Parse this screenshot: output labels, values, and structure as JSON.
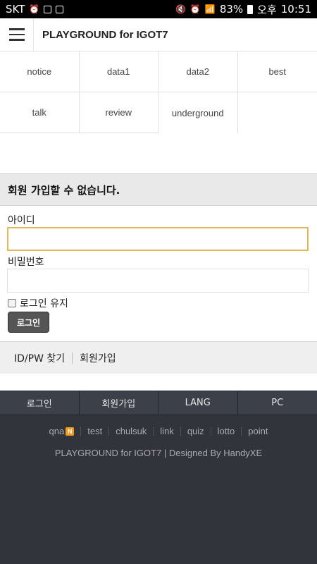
{
  "statusbar": {
    "carrier": "SKT",
    "battery": "83%",
    "ampm": "오후",
    "time": "10:51"
  },
  "header": {
    "title": "PLAYGROUND for IGOT7"
  },
  "categories": [
    [
      "notice",
      "data1",
      "data2",
      "best"
    ],
    [
      "talk",
      "review",
      "underground",
      ""
    ]
  ],
  "login": {
    "heading": "회원 가입할 수 없습니다.",
    "id_label": "아이디",
    "pw_label": "비밀번호",
    "id_value": "",
    "pw_value": "",
    "keep_label": "로그인 유지",
    "button": "로그인",
    "find_link": "ID/PW 찾기",
    "join_link": "회원가입"
  },
  "bottom_nav": [
    "로그인",
    "회원가입",
    "LANG",
    "PC"
  ],
  "footer": {
    "links": [
      "qna",
      "test",
      "chulsuk",
      "link",
      "quiz",
      "lotto",
      "point"
    ],
    "new_badge": "N",
    "copyright": "PLAYGROUND for IGOT7 | Designed By HandyXE"
  }
}
